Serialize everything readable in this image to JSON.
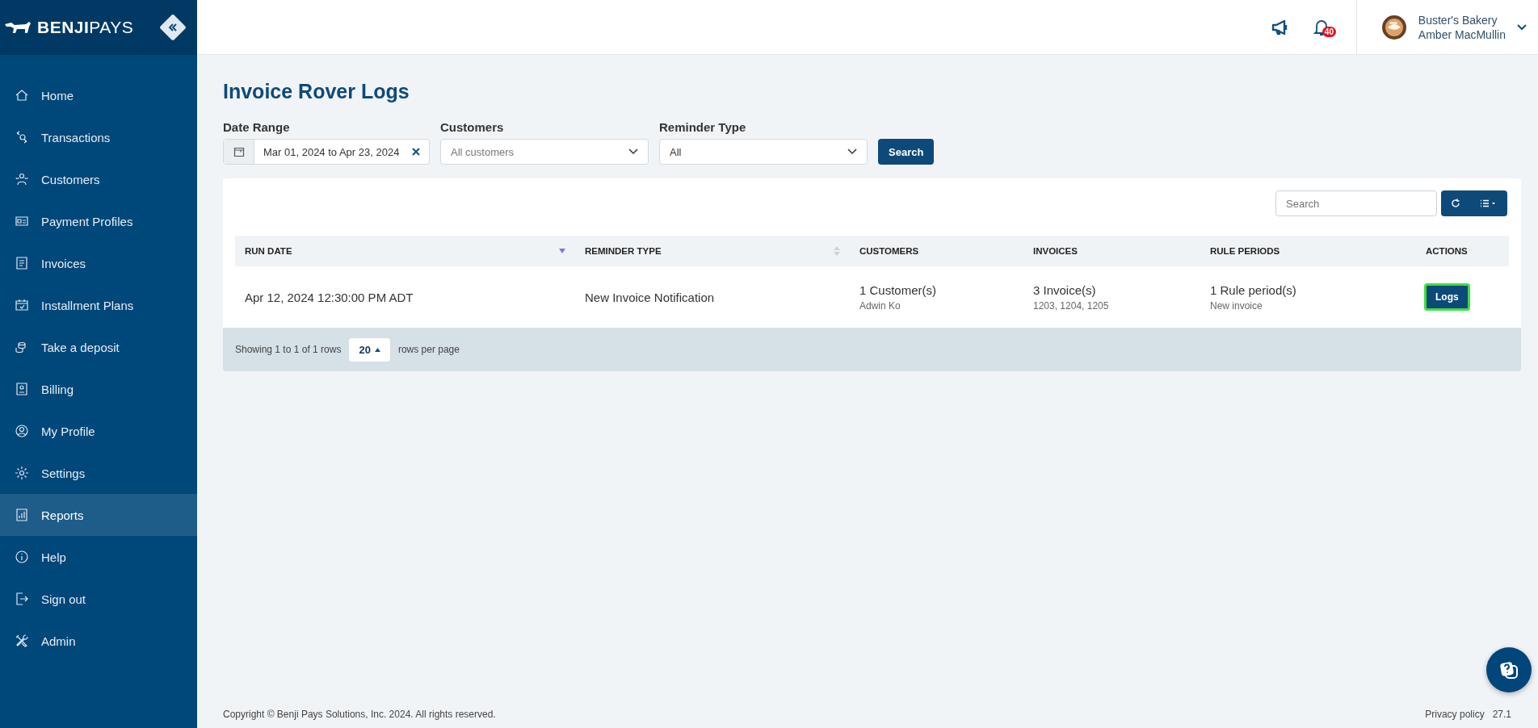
{
  "brand": {
    "name_bold": "BENJI",
    "name_light": "PAYS"
  },
  "sidebar": {
    "items": [
      {
        "label": "Home",
        "selected": false
      },
      {
        "label": "Transactions",
        "selected": false
      },
      {
        "label": "Customers",
        "selected": false
      },
      {
        "label": "Payment Profiles",
        "selected": false
      },
      {
        "label": "Invoices",
        "selected": false
      },
      {
        "label": "Installment Plans",
        "selected": false
      },
      {
        "label": "Take a deposit",
        "selected": false
      },
      {
        "label": "Billing",
        "selected": false
      },
      {
        "label": "My Profile",
        "selected": false
      },
      {
        "label": "Settings",
        "selected": false
      },
      {
        "label": "Reports",
        "selected": true
      },
      {
        "label": "Help",
        "selected": false
      },
      {
        "label": "Sign out",
        "selected": false
      },
      {
        "label": "Admin",
        "selected": false
      }
    ]
  },
  "header": {
    "notification_count": "40",
    "account": {
      "business": "Buster's Bakery",
      "user": "Amber MacMullin"
    }
  },
  "page": {
    "title": "Invoice Rover Logs"
  },
  "filters": {
    "date_range": {
      "label": "Date Range",
      "value": "Mar 01, 2024 to Apr 23, 2024"
    },
    "customers": {
      "label": "Customers",
      "placeholder": "All customers"
    },
    "reminder_type": {
      "label": "Reminder Type",
      "value": "All"
    },
    "search_button": "Search"
  },
  "table": {
    "search": {
      "placeholder": "Search"
    },
    "columns": [
      {
        "label": "RUN DATE",
        "sorted": true
      },
      {
        "label": "REMINDER TYPE",
        "sorted": false
      },
      {
        "label": "CUSTOMERS"
      },
      {
        "label": "INVOICES"
      },
      {
        "label": "RULE PERIODS"
      },
      {
        "label": "ACTIONS"
      }
    ],
    "rows": [
      {
        "run_date": "Apr 12, 2024 12:30:00 PM ADT",
        "reminder_type": "New Invoice Notification",
        "customers": {
          "main": "1 Customer(s)",
          "sub": "Adwin Ko"
        },
        "invoices": {
          "main": "3 Invoice(s)",
          "sub": "1203, 1204, 1205"
        },
        "rule_periods": {
          "main": "1 Rule period(s)",
          "sub": "New invoice"
        },
        "action": {
          "label": "Logs",
          "focused": true
        }
      }
    ]
  },
  "pagination": {
    "summary": "Showing 1 to 1 of 1 rows",
    "page_size": "20",
    "suffix": "rows per page"
  },
  "footer": {
    "copyright": "Copyright © Benji Pays Solutions, Inc. 2024. All rights reserved.",
    "privacy": "Privacy policy",
    "version": "27.1"
  }
}
